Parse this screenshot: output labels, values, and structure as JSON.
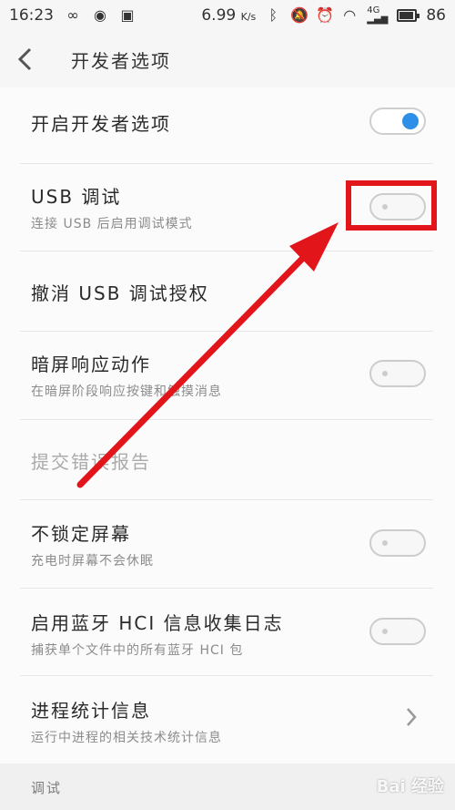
{
  "status_bar": {
    "time": "16:23",
    "net_speed": "6.99",
    "net_speed_unit": "K/s",
    "network_type": "4G",
    "battery_level": "86",
    "icons": [
      "infinity-icon",
      "circle-icon",
      "image-icon",
      "bluetooth-icon",
      "mute-icon",
      "alarm-icon",
      "wifi-icon",
      "signal-icon",
      "battery-icon"
    ]
  },
  "header": {
    "title": "开发者选项",
    "back_icon": "chevron-left-icon"
  },
  "settings": [
    {
      "title": "开启开发者选项",
      "subtitle": "",
      "control": "toggle",
      "checked": true
    },
    {
      "title": "USB 调试",
      "subtitle": "连接 USB 后启用调试模式",
      "control": "toggle",
      "checked": false
    },
    {
      "title": "撤消 USB 调试授权",
      "subtitle": "",
      "control": "none"
    },
    {
      "title": "暗屏响应动作",
      "subtitle": "在暗屏阶段响应按键和触摸消息",
      "control": "toggle",
      "checked": false
    },
    {
      "title": "提交错误报告",
      "subtitle": "",
      "control": "none",
      "disabled": true
    },
    {
      "title": "不锁定屏幕",
      "subtitle": "充电时屏幕不会休眠",
      "control": "toggle",
      "checked": false
    },
    {
      "title": "启用蓝牙 HCI 信息收集日志",
      "subtitle": "捕获单个文件中的所有蓝牙 HCI 包",
      "control": "toggle",
      "checked": false
    },
    {
      "title": "进程统计信息",
      "subtitle": "运行中进程的相关技术统计信息",
      "control": "chevron"
    }
  ],
  "section_label": "调试",
  "colors": {
    "accent": "#2d8fe8",
    "annotation_red": "#e2151b"
  },
  "watermark": "Bai 经验"
}
